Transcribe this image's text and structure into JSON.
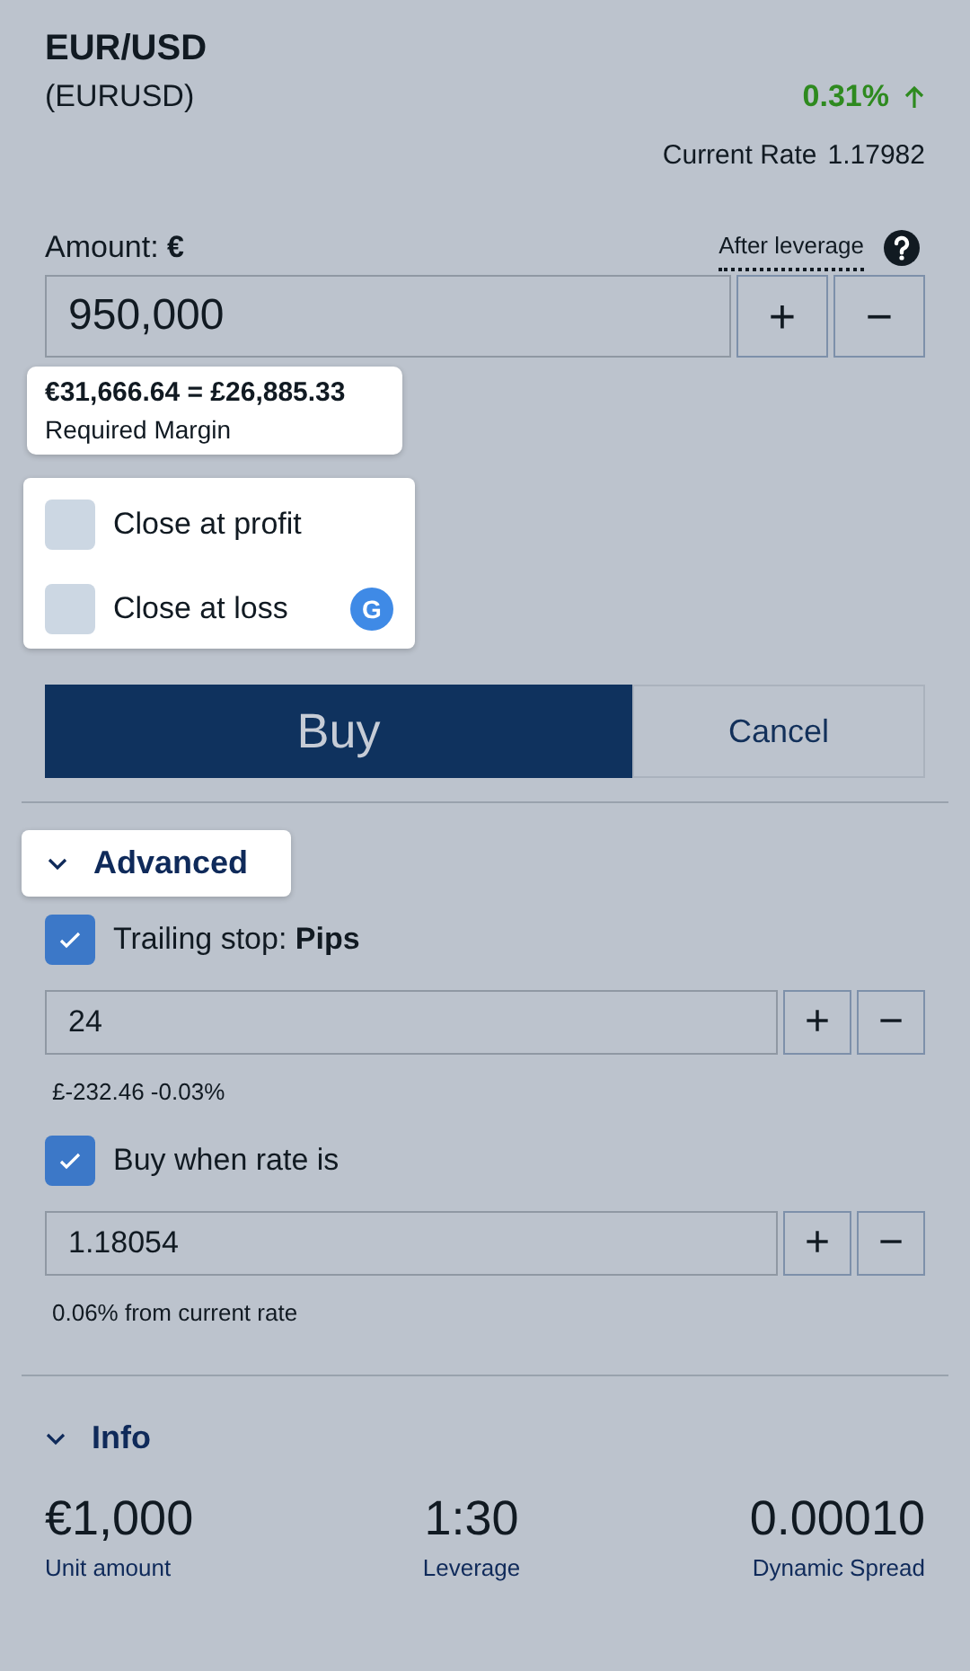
{
  "instrument": {
    "name": "EUR/USD",
    "symbol": "(EURUSD)",
    "change": "0.31%",
    "rising": true,
    "rate_label": "Current Rate",
    "rate_value": "1.17982"
  },
  "amount": {
    "label": "Amount: **€**",
    "leverage_link": "After leverage",
    "value": "950,000",
    "plus": "+",
    "minus": "−"
  },
  "margin": {
    "value": "€31,666.64 = £26,885.33",
    "label": "Required Margin"
  },
  "close_options": [
    {
      "label": "Close at profit",
      "checked": false
    },
    {
      "label": "Close at loss",
      "checked": false,
      "badge": "G"
    }
  ],
  "actions": {
    "buy": "Buy",
    "cancel": "Cancel"
  },
  "advanced": {
    "label": "Advanced",
    "expanded": true,
    "options": [
      {
        "label": "Trailing stop:  **Pips**",
        "checked": true,
        "value": "24",
        "plus": "+",
        "minus": "−",
        "note": "£-232.46  -0.03%"
      },
      {
        "label": "Buy when rate is",
        "checked": true,
        "value": "1.18054",
        "plus": "+",
        "minus": "−",
        "note": "0.06%  from current rate"
      }
    ]
  },
  "info": {
    "label": "Info",
    "expanded": true,
    "stats": [
      {
        "value": "€1,000",
        "label": "Unit amount"
      },
      {
        "value": "1:30",
        "label": "Leverage"
      },
      {
        "value": "0.00010",
        "label": "Dynamic Spread"
      }
    ]
  }
}
